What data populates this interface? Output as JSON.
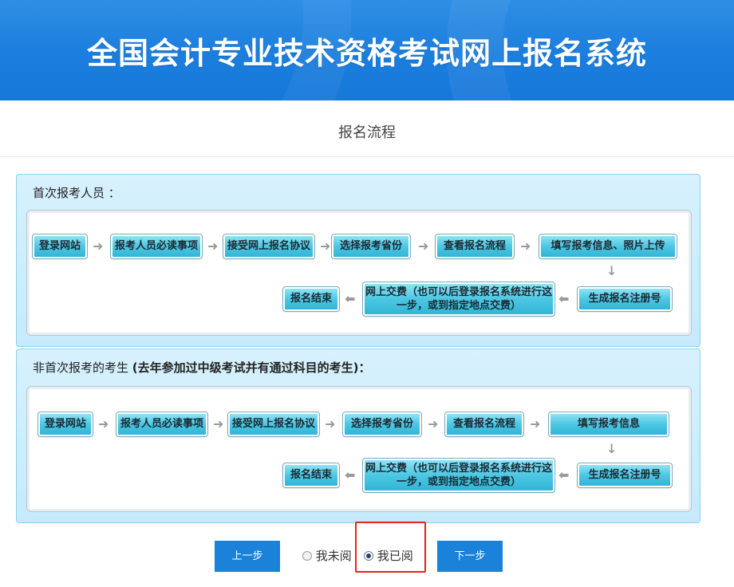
{
  "header": {
    "title": "全国会计专业技术资格考试网上报名系统"
  },
  "page": {
    "title": "报名流程"
  },
  "panel_first": {
    "heading": "首次报考人员 ：",
    "steps": {
      "s1": "登录网站",
      "s2": "报考人员必读事项",
      "s3": "接受网上报名协议",
      "s4": "选择报考省份",
      "s5": "查看报名流程",
      "s6": "填写报考信息、照片上传",
      "s7": "生成报名注册号",
      "s8": "网上交费（也可以后登录报名系统进行这一步，或到指定地点交费）",
      "s9": "报名结束"
    }
  },
  "panel_repeat": {
    "heading": "非首次报考的考生",
    "heading_note": "(去年参加过中级考试并有通过科目的考生)：",
    "steps": {
      "s1": "登录网站",
      "s2": "报考人员必读事项",
      "s3": "接受网上报名协议",
      "s4": "选择报考省份",
      "s5": "查看报名流程",
      "s6": "填写报考信息",
      "s7": "生成报名注册号",
      "s8": "网上交费（也可以后登录报名系统进行这一步，或到指定地点交费）",
      "s9": "报名结束"
    }
  },
  "footer": {
    "prev_label": "上一步",
    "next_label": "下一步",
    "not_read_label": "我未阅",
    "read_label": "我已阅",
    "read_selected": true
  },
  "colors": {
    "brand_blue": "#1a82d8",
    "highlight_red": "#e5231d",
    "step_cyan": "#4cc7e3"
  },
  "icons": {
    "arrow_right": "arrow-right-icon",
    "arrow_left": "arrow-left-icon",
    "arrow_down": "arrow-down-icon"
  }
}
